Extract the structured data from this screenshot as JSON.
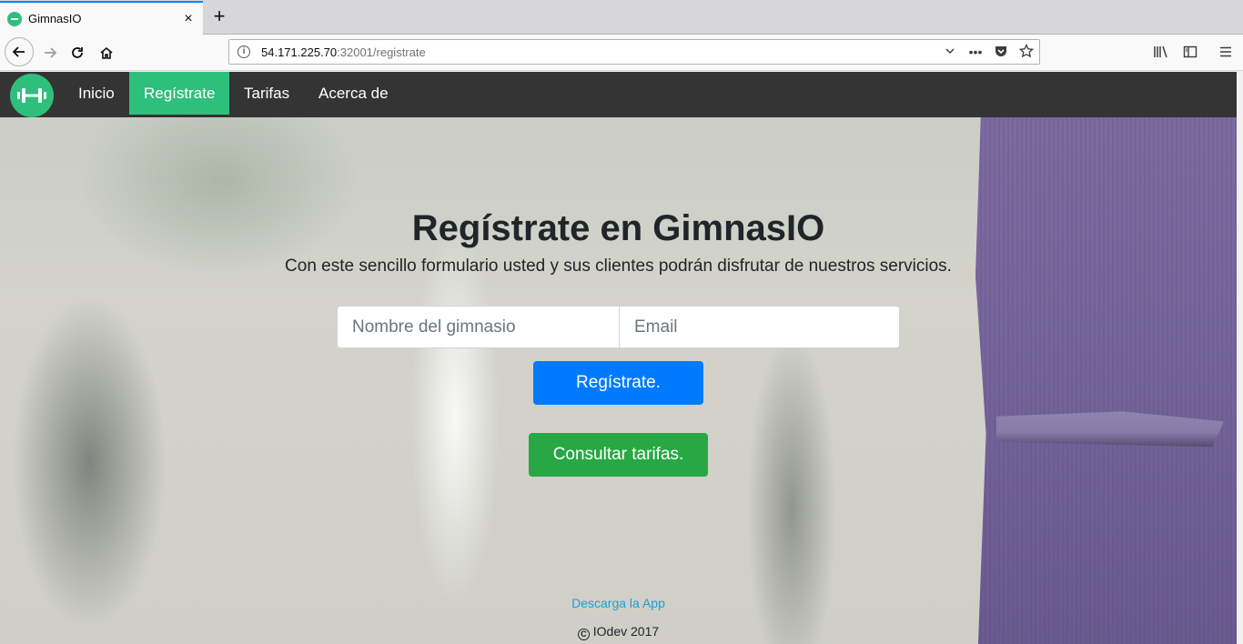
{
  "browser": {
    "tab": {
      "title": "GimnasIO",
      "close": "×"
    },
    "new_tab": "+",
    "url_host": "54.171.225.70",
    "url_path": ":32001/registrate",
    "url_more": "•••"
  },
  "site": {
    "nav": {
      "items": [
        {
          "label": "Inicio",
          "active": false
        },
        {
          "label": "Regístrate",
          "active": true
        },
        {
          "label": "Tarifas",
          "active": false
        },
        {
          "label": "Acerca de",
          "active": false
        }
      ]
    },
    "hero": {
      "title": "Regístrate en GimnasIO",
      "subtitle": "Con este sencillo formulario usted y sus clientes podrán disfrutar de nuestros servicios."
    },
    "form": {
      "gym_placeholder": "Nombre del gimnasio",
      "email_placeholder": "Email",
      "register_button": "Regístrate.",
      "tarifas_button": "Consultar tarifas."
    },
    "footer": {
      "app_link": "Descarga la App",
      "copy": "IOdev 2017"
    }
  },
  "colors": {
    "accent": "#2fbf7d",
    "nav_bg": "#343434",
    "primary": "#007bff",
    "success": "#28a745",
    "link": "#17a2d8"
  }
}
